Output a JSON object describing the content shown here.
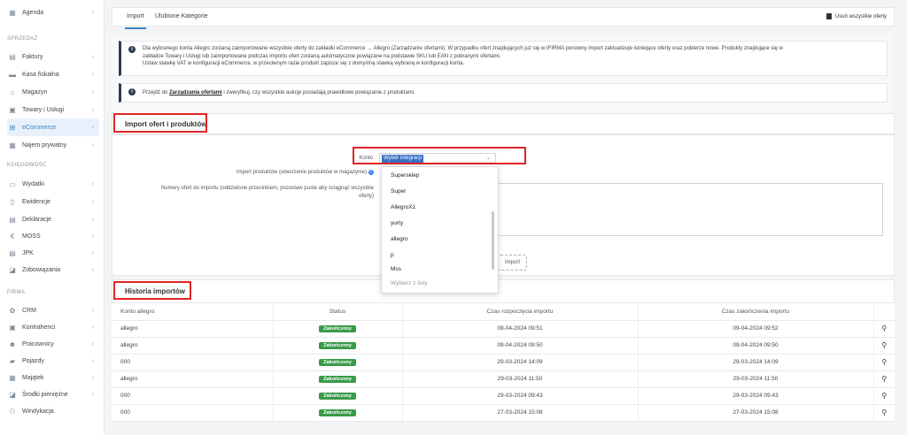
{
  "sidebar": {
    "top_item": {
      "label": "Agenda",
      "icon": "calendar-icon"
    },
    "sections": [
      {
        "title": "SPRZEDAŻ",
        "items": [
          {
            "label": "Faktury",
            "icon": "invoice-icon"
          },
          {
            "label": "Kasa fiskalna",
            "icon": "register-icon"
          },
          {
            "label": "Magazyn",
            "icon": "warehouse-icon"
          },
          {
            "label": "Towary i Usługi",
            "icon": "goods-icon"
          },
          {
            "label": "eCommerce",
            "icon": "cart-icon",
            "active": true
          },
          {
            "label": "Najem prywatny",
            "icon": "rental-icon"
          }
        ]
      },
      {
        "title": "KSIĘGOWOŚĆ",
        "items": [
          {
            "label": "Wydatki",
            "icon": "wallet-icon"
          },
          {
            "label": "Ewidencje",
            "icon": "document-icon"
          },
          {
            "label": "Deklaracje",
            "icon": "declaration-icon"
          },
          {
            "label": "MOSS",
            "icon": "euro-icon"
          },
          {
            "label": "JPK",
            "icon": "jpk-icon"
          },
          {
            "label": "Zobowiązania",
            "icon": "obligations-icon"
          }
        ]
      },
      {
        "title": "FIRMA",
        "items": [
          {
            "label": "CRM",
            "icon": "crm-icon"
          },
          {
            "label": "Kontrahenci",
            "icon": "contacts-icon"
          },
          {
            "label": "Pracownicy",
            "icon": "employees-icon"
          },
          {
            "label": "Pojazdy",
            "icon": "vehicle-icon"
          },
          {
            "label": "Majątek",
            "icon": "assets-icon"
          },
          {
            "label": "Środki pieniężne",
            "icon": "money-icon"
          },
          {
            "label": "Windykacja",
            "icon": "collection-icon"
          }
        ]
      }
    ]
  },
  "tabs": [
    {
      "label": "Import",
      "active": true
    },
    {
      "label": "Ulubione Kategorie"
    }
  ],
  "delete_all_label": "Usuń wszystkie oferty",
  "info1": {
    "line1": "Dla wybranego konta Allegro zostaną zaimportowane wszystkie oferty do zakładki eCommerce → Allegro (Zarządzanie ofertami). W przypadku ofert znajdujących już się w IFIRMA ponowny import zaktualizuje istniejące oferty oraz pobierze nowe. Produkty znajdujące się w",
    "line2": "zakładce Towary i Usługi lub zaimportowane podczas importu ofert zostaną automatycznie powiązane na podstawie SKU lub EAN z pobranymi ofertami.",
    "line3": "Ustaw stawkę VAT w konfiguracji eCommerce, w przeciwnym razie produkt zapisze się z domyślną stawką wybraną w konfiguracji konta."
  },
  "info2": {
    "prefix": "Przejdź do ",
    "link": "Zarządzania ofertami",
    "suffix": " i zweryfikuj, czy wszystkie aukcje posiadają prawidłowe powiązanie z produktami."
  },
  "import_section": {
    "title": "Import ofert i produktów",
    "konto_label": "Konto",
    "select_value": "Wybór integracji",
    "products_label": "Import produktów (utworzenie produktów w magazynie)",
    "numbers_label_1": "Numery ofert do importu (oddzielone przecinkiem, pozostaw puste aby ściągnąć wszystkie",
    "numbers_label_2": "oferty)",
    "import_button": "Import",
    "dropdown_options": [
      "Supersklep",
      "Super",
      "AllegroX1",
      "yurty",
      "allegro",
      "p",
      "Mss",
      "Wybierz z listy"
    ]
  },
  "history": {
    "title": "Historia importów",
    "columns": [
      "Konto allegro",
      "Status",
      "Czas rozpoczęcia importu",
      "Czas zakończenia importu"
    ],
    "rows": [
      {
        "konto": "allegro",
        "status": "Zakończony",
        "start": "09-04-2024 09:51",
        "end": "09-04-2024 09:52"
      },
      {
        "konto": "allegro",
        "status": "Zakończony",
        "start": "09-04-2024 09:50",
        "end": "09-04-2024 09:50"
      },
      {
        "konto": "000",
        "status": "Zakończony",
        "start": "29-03-2024 14:09",
        "end": "29-03-2024 14:09"
      },
      {
        "konto": "allegro",
        "status": "Zakończony",
        "start": "29-03-2024 11:50",
        "end": "29-03-2024 11:50"
      },
      {
        "konto": "000",
        "status": "Zakończony",
        "start": "29-03-2024 09:43",
        "end": "29-03-2024 09:43"
      },
      {
        "konto": "000",
        "status": "Zakończony",
        "start": "27-03-2024 15:08",
        "end": "27-03-2024 15:08"
      }
    ]
  },
  "colors": {
    "accent": "#3b82c4",
    "success": "#3a9a4a",
    "highlight": "#e02424"
  }
}
